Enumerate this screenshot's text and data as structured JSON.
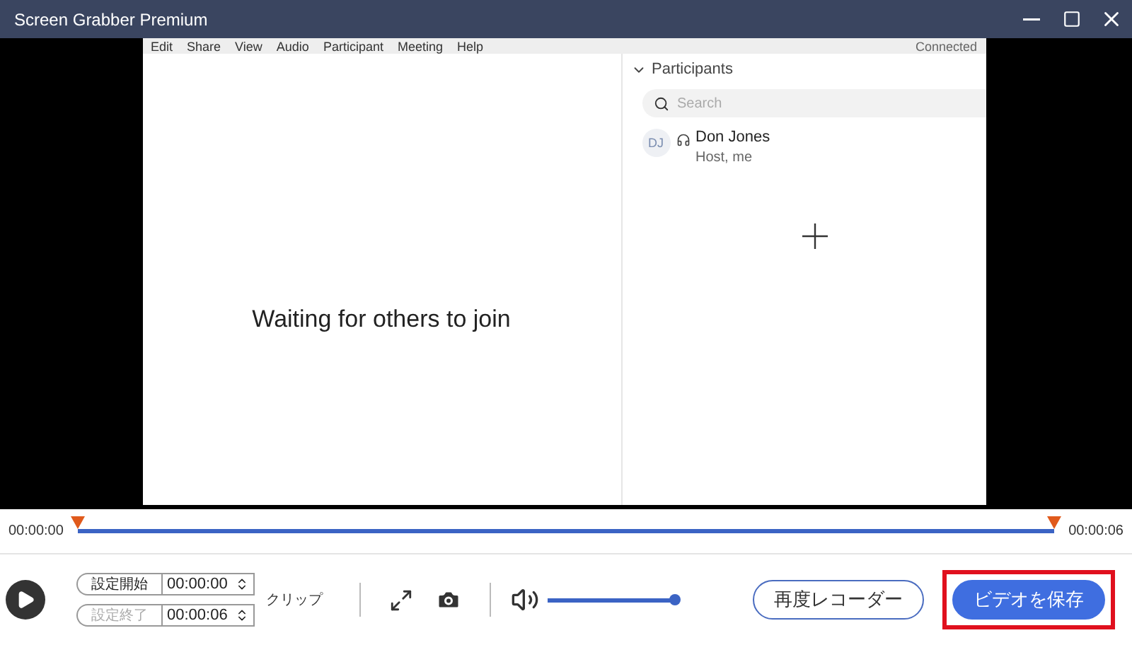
{
  "window": {
    "title": "Screen Grabber Premium"
  },
  "video": {
    "menu": [
      "Edit",
      "Share",
      "View",
      "Audio",
      "Participant",
      "Meeting",
      "Help"
    ],
    "status": "Connected",
    "message": "Waiting for others to join",
    "participants": {
      "title": "Participants",
      "expanded": true,
      "search_placeholder": "Search",
      "people": [
        {
          "initials": "DJ",
          "name": "Don Jones",
          "role": "Host, me"
        }
      ]
    }
  },
  "timeline": {
    "start_time": "00:00:00",
    "end_time": "00:00:06",
    "level": 1
  },
  "clip": {
    "start_button": "設定開始",
    "start_value": "00:00:00",
    "end_button": "設定終了",
    "end_value": "00:00:06",
    "end_disabled": true,
    "label": "クリップ"
  },
  "volume": {
    "level": 1
  },
  "buttons": [
    {
      "label": "再度レコーダー",
      "kind": "outline",
      "highlighted": false
    },
    {
      "label": "ビデオを保存",
      "kind": "primary",
      "highlighted": true
    }
  ]
}
